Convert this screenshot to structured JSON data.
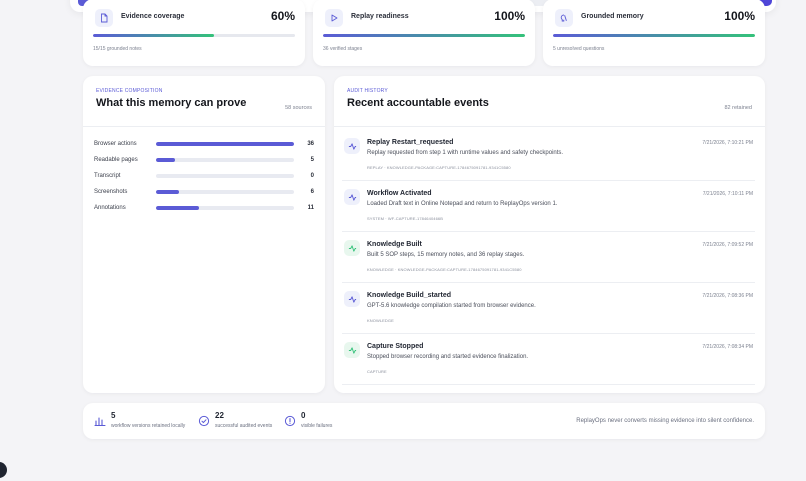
{
  "metrics": [
    {
      "title": "Evidence coverage",
      "value": "60%",
      "progress": 0.6,
      "sub": "15/15 grounded notes",
      "icon": "document-icon"
    },
    {
      "title": "Replay readiness",
      "value": "100%",
      "progress": 1.0,
      "sub": "36 verified stages",
      "icon": "play-icon"
    },
    {
      "title": "Grounded memory",
      "value": "100%",
      "progress": 1.0,
      "sub": "5 unresolved questions",
      "icon": "brain-icon"
    }
  ],
  "composition": {
    "eyebrow": "EVIDENCE COMPOSITION",
    "title": "What this memory can prove",
    "count": "58 sources",
    "rows": [
      {
        "label": "Browser actions",
        "value": "36",
        "fraction": 1.0
      },
      {
        "label": "Readable pages",
        "value": "5",
        "fraction": 0.14
      },
      {
        "label": "Transcript",
        "value": "0",
        "fraction": 0
      },
      {
        "label": "Screenshots",
        "value": "6",
        "fraction": 0.17
      },
      {
        "label": "Annotations",
        "value": "11",
        "fraction": 0.31
      }
    ]
  },
  "audit": {
    "eyebrow": "AUDIT HISTORY",
    "title": "Recent accountable events",
    "count": "82 retained",
    "events": [
      {
        "title": "Replay Restart_requested",
        "time": "7/21/2026, 7:10:21 PM",
        "desc": "Replay requested from step 1 with runtime values and safety checkpoints.",
        "meta": "REPLAY · KNOWLEDGE-PACKAGE:CAPTURE-1784675091781-9341C5580",
        "tone": "blue"
      },
      {
        "title": "Workflow Activated",
        "time": "7/21/2026, 7:10:11 PM",
        "desc": "Loaded Draft text in Online Notepad and return to ReplayOps version 1.",
        "meta": "SYSTEM · WF-CAPTURE-1784640466B",
        "tone": "blue"
      },
      {
        "title": "Knowledge Built",
        "time": "7/21/2026, 7:09:52 PM",
        "desc": "Built 5 SOP steps, 15 memory notes, and 36 replay stages.",
        "meta": "KNOWLEDGE · KNOWLEDGE-PACKAGE:CAPTURE-1784675091781-9341C5580",
        "tone": "green"
      },
      {
        "title": "Knowledge Build_started",
        "time": "7/21/2026, 7:08:36 PM",
        "desc": "GPT-5.6 knowledge compilation started from browser evidence.",
        "meta": "KNOWLEDGE",
        "tone": "blue"
      },
      {
        "title": "Capture Stopped",
        "time": "7/21/2026, 7:08:34 PM",
        "desc": "Stopped browser recording and started evidence finalization.",
        "meta": "CAPTURE",
        "tone": "green"
      }
    ]
  },
  "footer": {
    "stats": [
      {
        "num": "5",
        "label": "workflow versions retained locally",
        "icon": "bar-chart-icon"
      },
      {
        "num": "22",
        "label": "successful audited events",
        "icon": "check-circle-icon"
      },
      {
        "num": "0",
        "label": "visible failures",
        "icon": "alert-circle-icon"
      }
    ],
    "note": "ReplayOps never converts missing evidence into silent confidence."
  },
  "colors": {
    "accent": "#5b5bd6",
    "success": "#34c27a"
  }
}
